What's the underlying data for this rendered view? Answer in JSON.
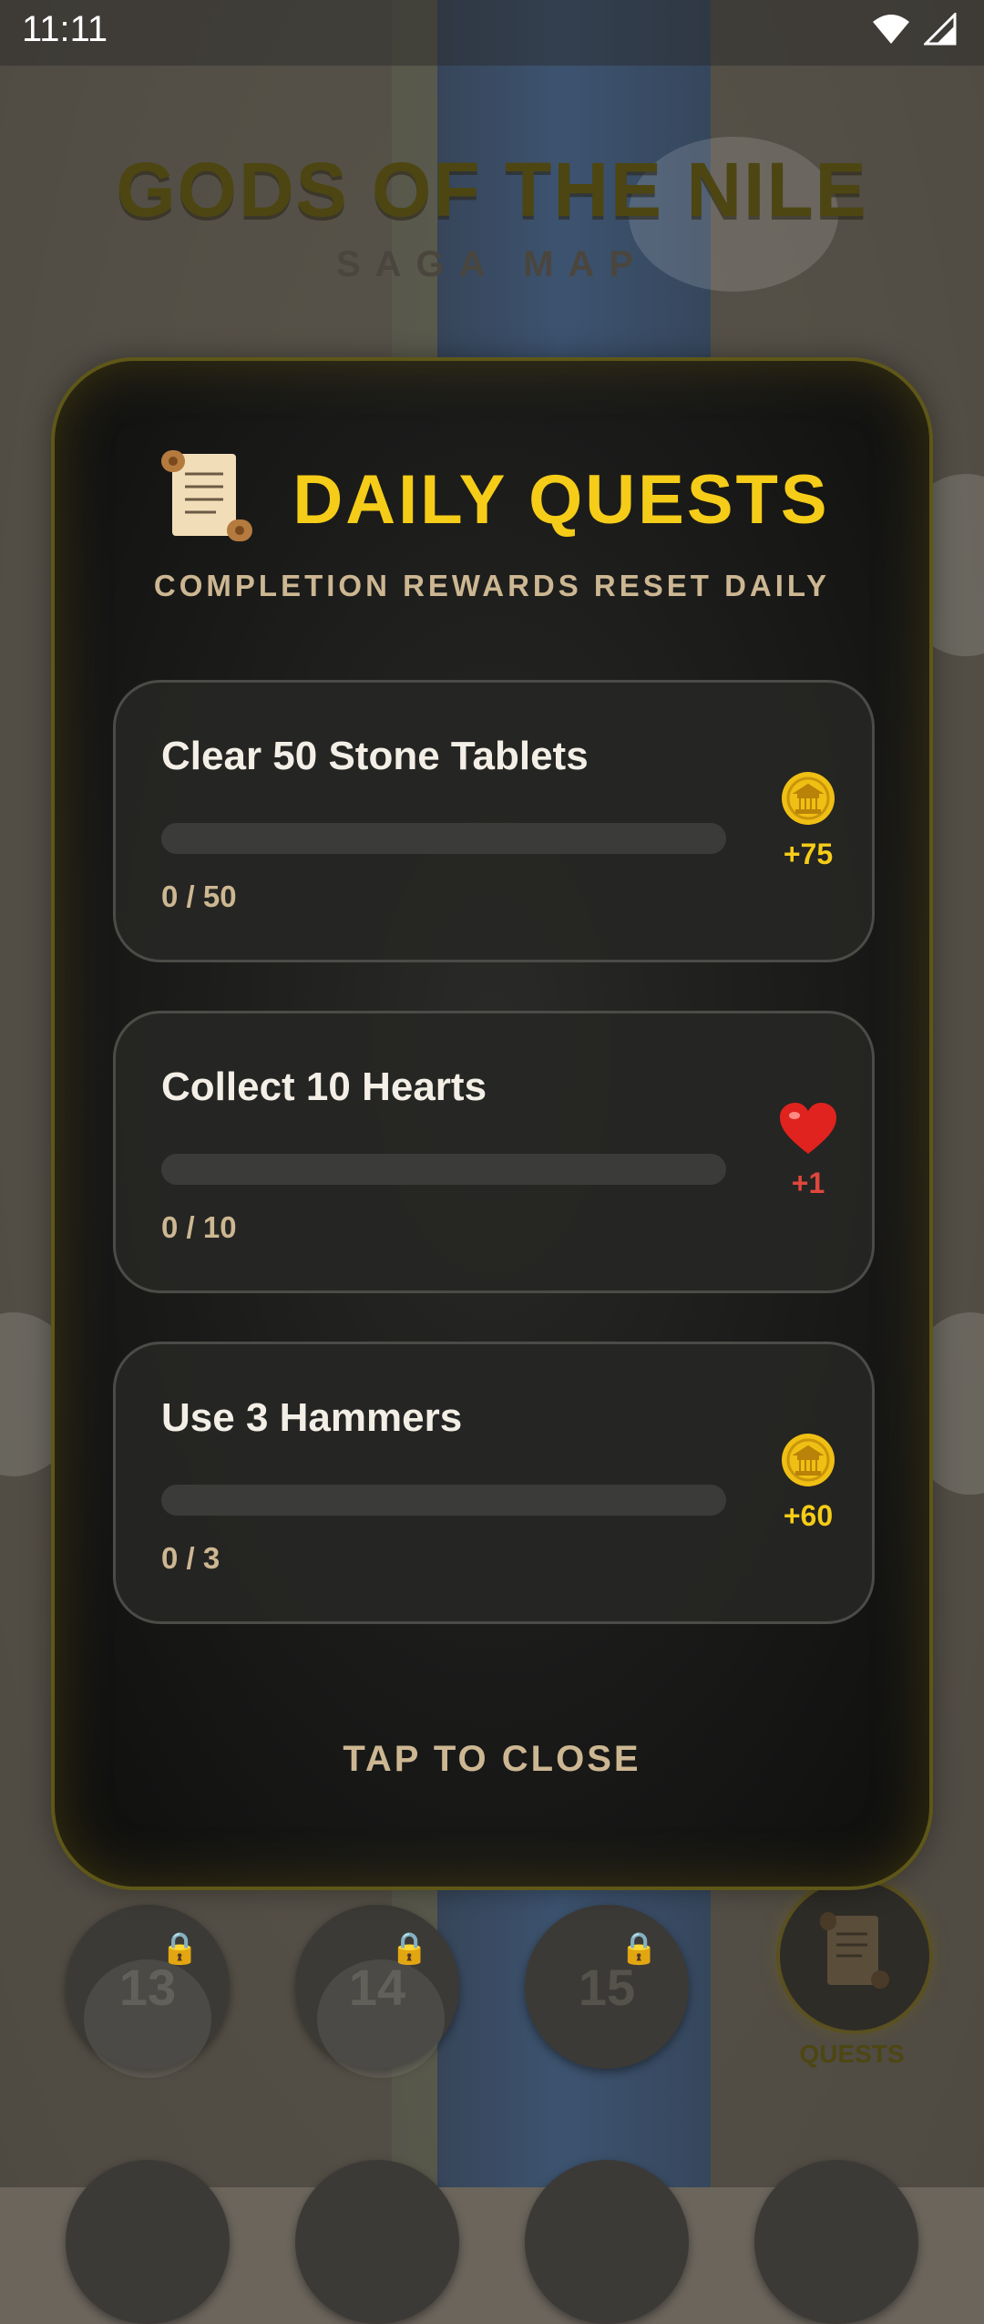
{
  "status_bar": {
    "time": "11:11",
    "icons": [
      "wifi-icon",
      "signal-icon"
    ]
  },
  "game": {
    "title": "GODS OF THE NILE",
    "subtitle": "SAGA MAP"
  },
  "modal": {
    "title": "DAILY QUESTS",
    "icon": "scroll-icon",
    "subtitle": "COMPLETION REWARDS RESET DAILY",
    "quests": [
      {
        "name": "Clear 50 Stone Tablets",
        "progress_text": "0 / 50",
        "progress": 0,
        "reward_icon": "coin-icon",
        "reward": "+75",
        "reward_color": "#f5cc18"
      },
      {
        "name": "Collect 10 Hearts",
        "progress_text": "0 / 10",
        "progress": 0,
        "reward_icon": "heart-icon",
        "reward": "+1",
        "reward_color": "#e0463c"
      },
      {
        "name": "Use 3 Hammers",
        "progress_text": "0 / 3",
        "progress": 0,
        "reward_icon": "coin-icon",
        "reward": "+60",
        "reward_color": "#f5cc18"
      }
    ],
    "close_label": "TAP TO CLOSE"
  },
  "map": {
    "levels": [
      {
        "number": "13",
        "locked": true
      },
      {
        "number": "14",
        "locked": true
      },
      {
        "number": "15",
        "locked": true
      }
    ],
    "quests_button_label": "QUESTS"
  },
  "colors": {
    "accent": "#f5cc18",
    "secondary_text": "#cdb792",
    "heart": "#e0463c"
  }
}
